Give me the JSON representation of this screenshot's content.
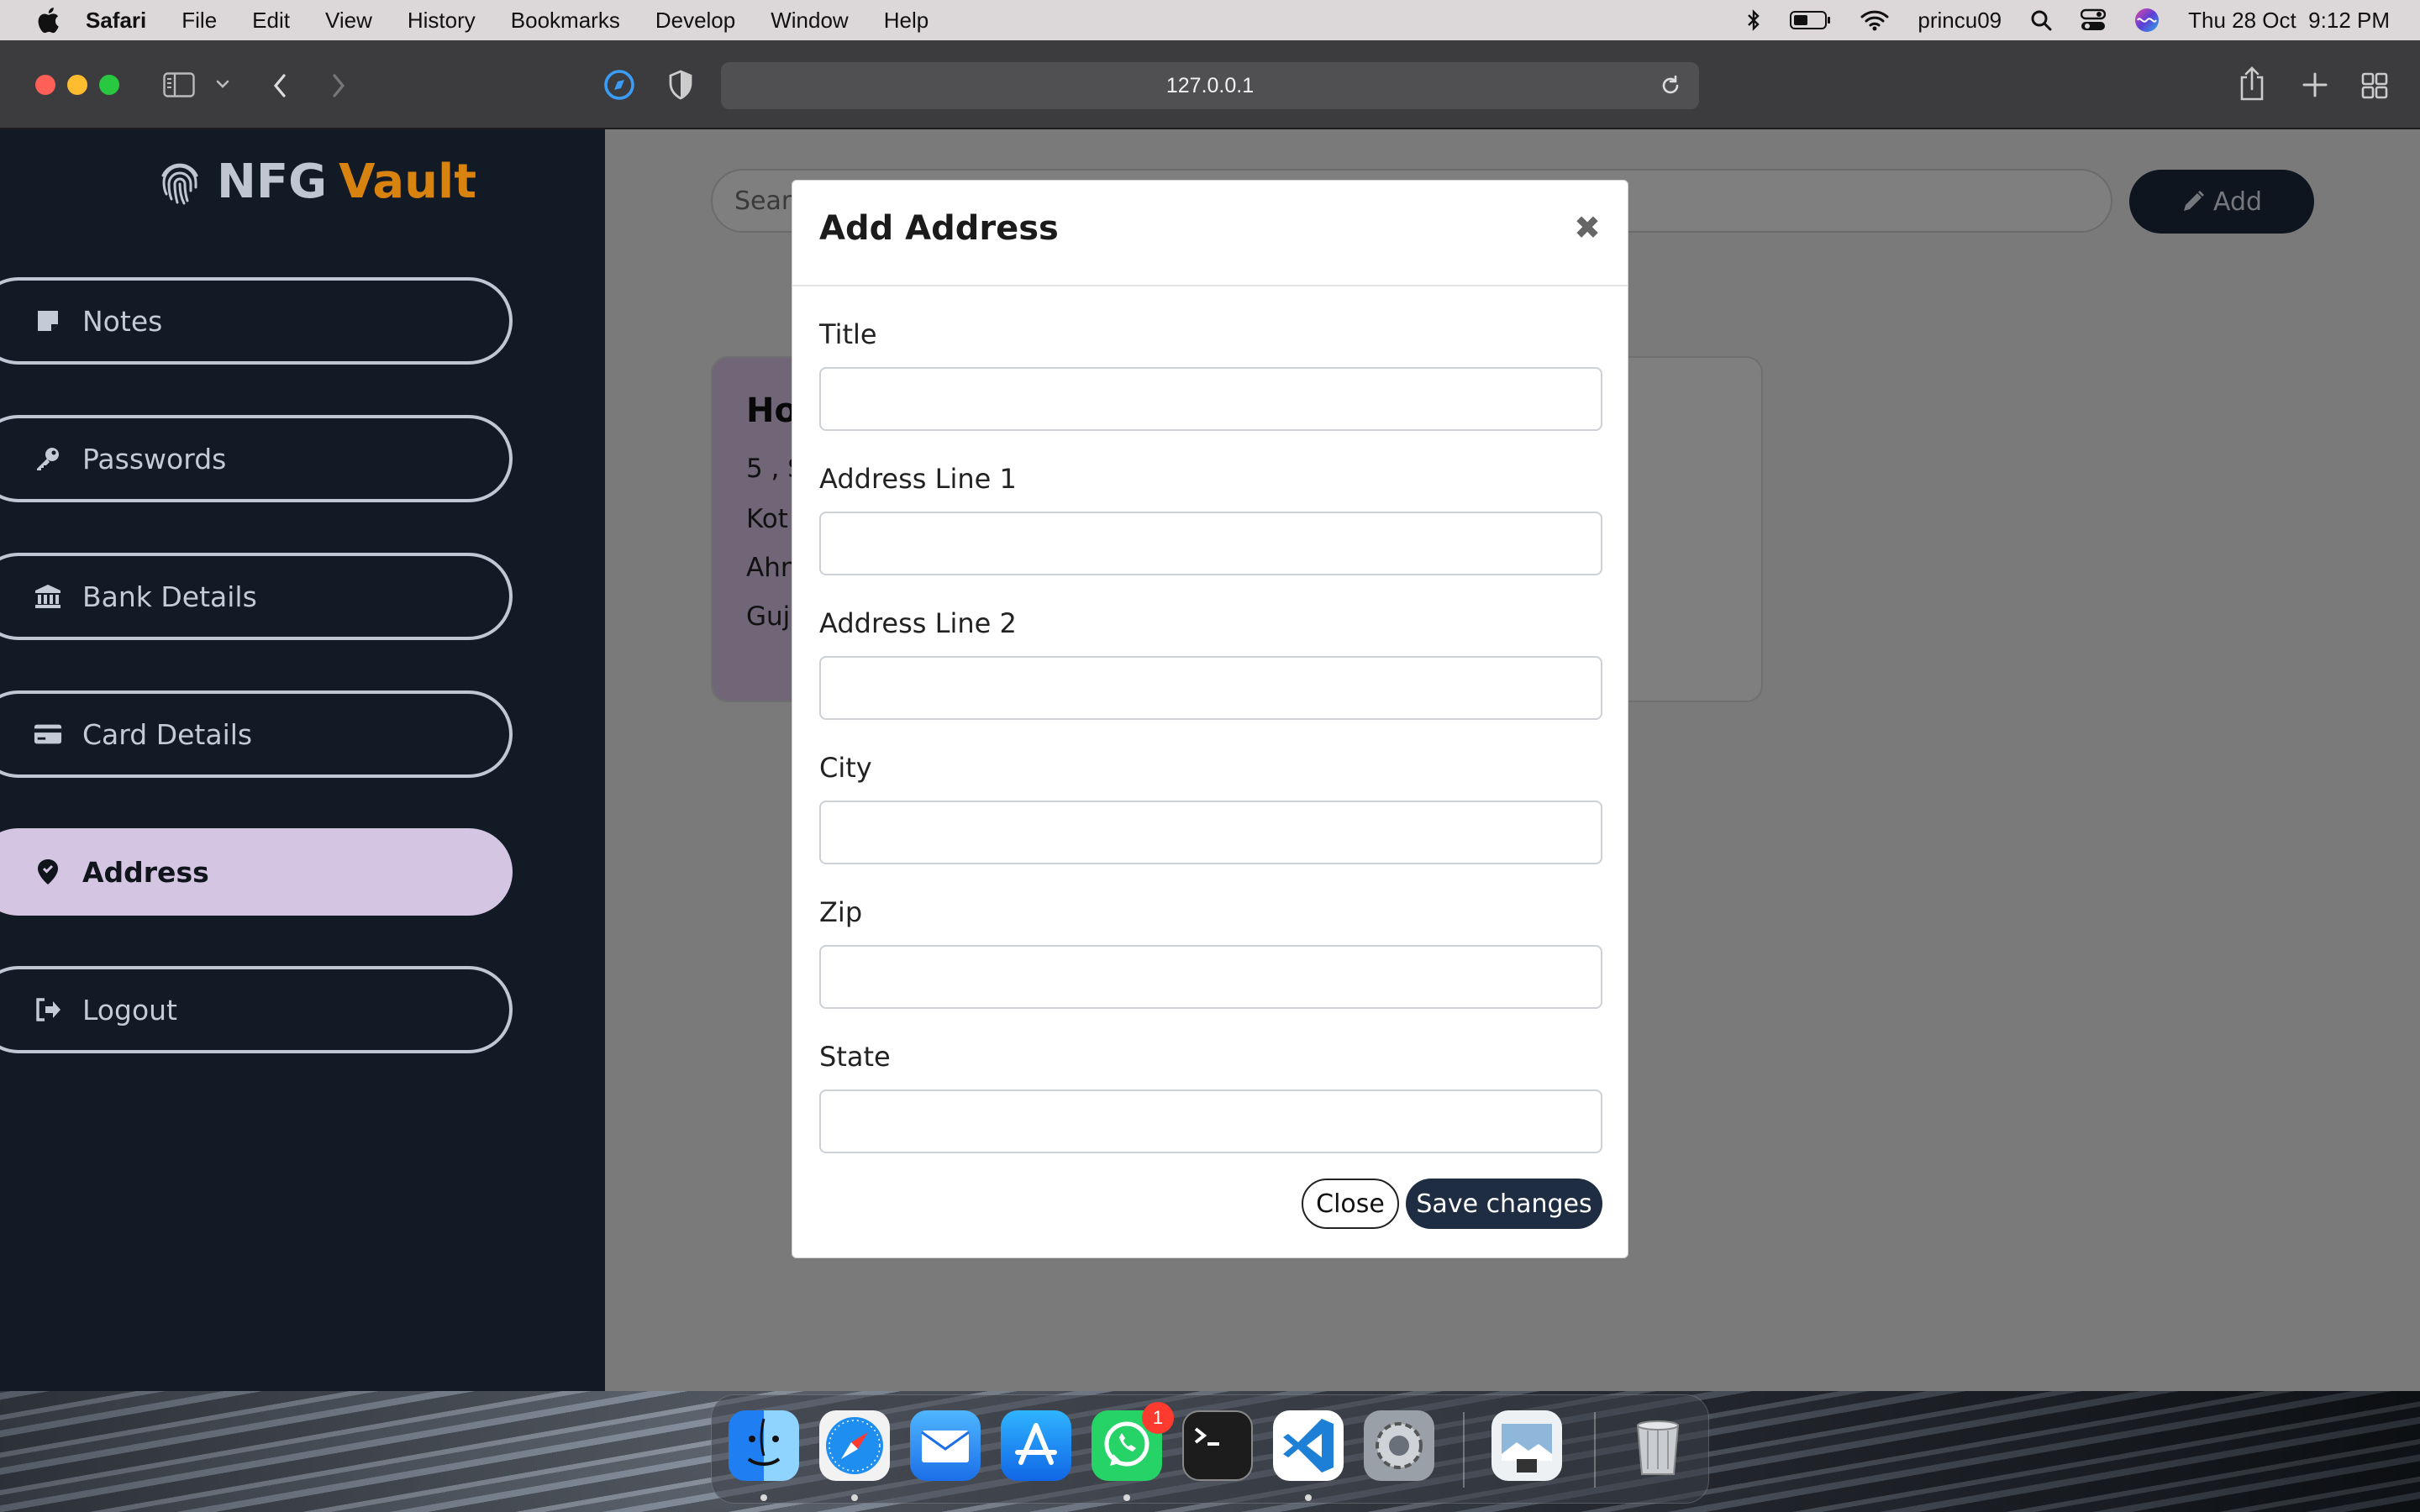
{
  "menubar": {
    "app_name": "Safari",
    "menus": [
      "File",
      "Edit",
      "View",
      "History",
      "Bookmarks",
      "Develop",
      "Window",
      "Help"
    ],
    "username": "princu09",
    "datetime": "Thu 28 Oct  9:12 PM"
  },
  "browser": {
    "url": "127.0.0.1"
  },
  "sidebar": {
    "brand_part1": "NFG",
    "brand_part2": "Vault",
    "items": [
      {
        "label": "Notes",
        "icon": "note-icon"
      },
      {
        "label": "Passwords",
        "icon": "key-icon"
      },
      {
        "label": "Bank Details",
        "icon": "bank-icon"
      },
      {
        "label": "Card Details",
        "icon": "credit-card-icon"
      },
      {
        "label": "Address",
        "icon": "map-pin-icon",
        "active": true
      },
      {
        "label": "Logout",
        "icon": "logout-icon"
      }
    ]
  },
  "main": {
    "search_placeholder": "Search",
    "add_label": "Add",
    "card": {
      "title": "Ho",
      "lines": [
        "5 , S",
        "Kot",
        "Ahn",
        "Guj"
      ]
    }
  },
  "modal": {
    "title": "Add Address",
    "close_symbol": "✖",
    "fields": [
      {
        "label": "Title",
        "value": ""
      },
      {
        "label": "Address Line 1",
        "value": ""
      },
      {
        "label": "Address Line 2",
        "value": ""
      },
      {
        "label": "City",
        "value": ""
      },
      {
        "label": "Zip",
        "value": ""
      },
      {
        "label": "State",
        "value": ""
      }
    ],
    "close_button": "Close",
    "save_button": "Save changes"
  },
  "dock": {
    "apps": [
      "Finder",
      "Safari",
      "Mail",
      "App Store",
      "WhatsApp",
      "Terminal",
      "Visual Studio Code",
      "System Preferences",
      "Preview",
      "Trash"
    ],
    "whatsapp_badge": "1"
  },
  "colors": {
    "sidebar_bg": "#121a25",
    "brand_accent": "#d8820f",
    "active_nav": "#d4c6e3",
    "primary_button": "#1f2d42"
  }
}
